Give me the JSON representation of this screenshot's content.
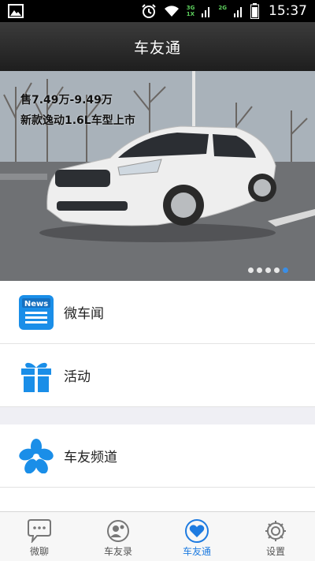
{
  "status_bar": {
    "time": "15:37",
    "network_top": "3G",
    "network_bottom": "1X",
    "network2_top": "2G"
  },
  "header": {
    "title": "车友通"
  },
  "banner": {
    "line1": "售7.49万-9.49万",
    "line2": "新款逸动1.6L车型上市",
    "page_count": 5,
    "active_page": 4
  },
  "menu": {
    "group1": [
      {
        "label": "微车闻",
        "icon": "news-icon"
      },
      {
        "label": "活动",
        "icon": "gift-icon"
      }
    ],
    "group2": [
      {
        "label": "车友频道",
        "icon": "channel-flower-icon"
      }
    ]
  },
  "tabs": [
    {
      "label": "微聊",
      "icon": "chat-bubble-icon",
      "active": false
    },
    {
      "label": "车友录",
      "icon": "contacts-icon",
      "active": false
    },
    {
      "label": "车友通",
      "icon": "heart-icon",
      "active": true
    },
    {
      "label": "设置",
      "icon": "gear-icon",
      "active": false
    }
  ],
  "colors": {
    "accent": "#1e7be0",
    "icon_blue": "#1a8ee8"
  }
}
